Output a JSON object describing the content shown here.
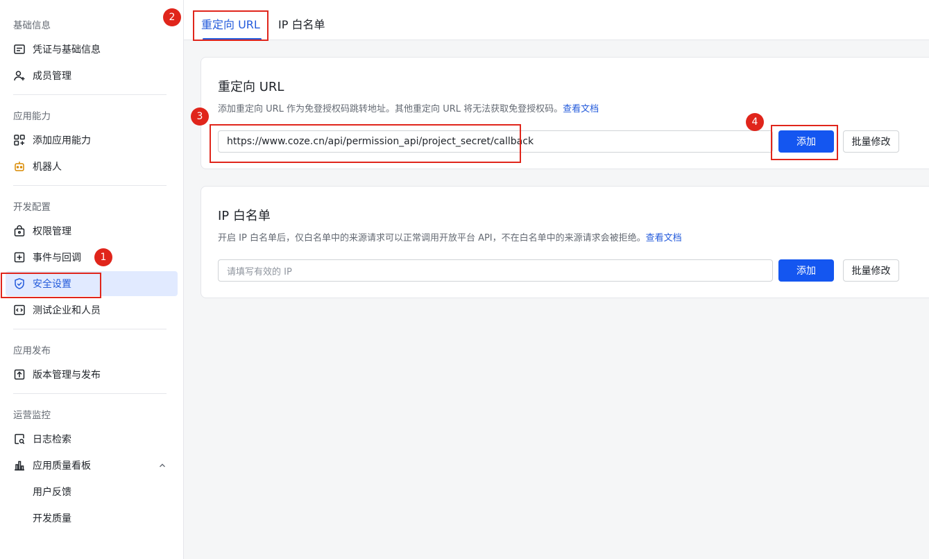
{
  "sidebar": {
    "sections": [
      {
        "title": "基础信息",
        "items": [
          {
            "label": "凭证与基础信息",
            "icon": "credential-icon"
          },
          {
            "label": "成员管理",
            "icon": "member-add-icon"
          }
        ]
      },
      {
        "title": "应用能力",
        "items": [
          {
            "label": "添加应用能力",
            "icon": "apps-add-icon"
          },
          {
            "label": "机器人",
            "icon": "robot-icon"
          }
        ]
      },
      {
        "title": "开发配置",
        "items": [
          {
            "label": "权限管理",
            "icon": "permission-icon"
          },
          {
            "label": "事件与回调",
            "icon": "event-icon"
          },
          {
            "label": "安全设置",
            "icon": "shield-icon",
            "active": true
          },
          {
            "label": "测试企业和人员",
            "icon": "code-icon"
          }
        ]
      },
      {
        "title": "应用发布",
        "items": [
          {
            "label": "版本管理与发布",
            "icon": "upload-icon"
          }
        ]
      },
      {
        "title": "运营监控",
        "items": [
          {
            "label": "日志检索",
            "icon": "log-search-icon"
          },
          {
            "label": "应用质量看板",
            "icon": "chart-icon",
            "expanded": true
          },
          {
            "label": "用户反馈",
            "sub": true
          },
          {
            "label": "开发质量",
            "sub": true
          }
        ]
      }
    ]
  },
  "tabs": [
    {
      "label": "重定向 URL",
      "active": true
    },
    {
      "label": "IP 白名单",
      "active": false
    }
  ],
  "redirect": {
    "title": "重定向 URL",
    "desc": "添加重定向 URL 作为免登授权码跳转地址。其他重定向 URL 将无法获取免登授权码。",
    "doc_link": "查看文档",
    "input_value": "https://www.coze.cn/api/permission_api/project_secret/callback",
    "add_label": "添加",
    "batch_label": "批量修改"
  },
  "ipwhitelist": {
    "title": "IP 白名单",
    "desc": "开启 IP 白名单后，仅白名单中的来源请求可以正常调用开放平台 API，不在白名单中的来源请求会被拒绝。",
    "doc_link": "查看文档",
    "placeholder": "请填写有效的 IP",
    "add_label": "添加",
    "batch_label": "批量修改"
  },
  "annotations": [
    "1",
    "2",
    "3",
    "4"
  ],
  "colors": {
    "accent": "#245bdb",
    "primary_button": "#1456f0",
    "annotation": "#e0251b",
    "active_bg": "#e1eaff"
  }
}
